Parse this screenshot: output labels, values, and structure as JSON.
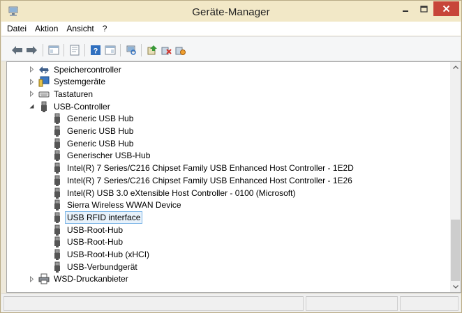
{
  "window": {
    "title": "Geräte-Manager",
    "accent_color": "#c7453a",
    "titlebar_color": "#f2e8c7"
  },
  "menu": {
    "items": [
      "Datei",
      "Aktion",
      "Ansicht",
      "?"
    ]
  },
  "toolbar": {
    "buttons": [
      "back-icon",
      "forward-icon",
      "show-hide-tree-icon",
      "properties-icon",
      "help-icon",
      "view-icon",
      "scan-hardware-icon",
      "update-driver-icon",
      "disable-device-icon",
      "uninstall-device-icon"
    ]
  },
  "tree": {
    "nodes": [
      {
        "label": "Speichercontroller",
        "level": 1,
        "state": "collapsed",
        "icon": "storage-controller-icon"
      },
      {
        "label": "Systemgeräte",
        "level": 1,
        "state": "collapsed",
        "icon": "system-devices-icon"
      },
      {
        "label": "Tastaturen",
        "level": 1,
        "state": "collapsed",
        "icon": "keyboard-icon"
      },
      {
        "label": "USB-Controller",
        "level": 1,
        "state": "expanded",
        "icon": "usb-icon"
      },
      {
        "label": "Generic USB Hub",
        "level": 2,
        "icon": "usb-device-icon"
      },
      {
        "label": "Generic USB Hub",
        "level": 2,
        "icon": "usb-device-icon"
      },
      {
        "label": "Generic USB Hub",
        "level": 2,
        "icon": "usb-device-icon"
      },
      {
        "label": "Generischer USB-Hub",
        "level": 2,
        "icon": "usb-device-icon"
      },
      {
        "label": "Intel(R) 7 Series/C216 Chipset Family USB Enhanced Host Controller - 1E2D",
        "level": 2,
        "icon": "usb-device-icon"
      },
      {
        "label": "Intel(R) 7 Series/C216 Chipset Family USB Enhanced Host Controller - 1E26",
        "level": 2,
        "icon": "usb-device-icon"
      },
      {
        "label": "Intel(R) USB 3.0 eXtensible Host Controller - 0100 (Microsoft)",
        "level": 2,
        "icon": "usb-device-icon"
      },
      {
        "label": "Sierra Wireless WWAN Device",
        "level": 2,
        "icon": "usb-device-icon"
      },
      {
        "label": "USB RFID interface",
        "level": 2,
        "icon": "usb-device-icon",
        "selected": true
      },
      {
        "label": "USB-Root-Hub",
        "level": 2,
        "icon": "usb-device-icon"
      },
      {
        "label": "USB-Root-Hub",
        "level": 2,
        "icon": "usb-device-icon"
      },
      {
        "label": "USB-Root-Hub (xHCI)",
        "level": 2,
        "icon": "usb-device-icon"
      },
      {
        "label": "USB-Verbundgerät",
        "level": 2,
        "icon": "usb-device-icon"
      },
      {
        "label": "WSD-Druckanbieter",
        "level": 1,
        "state": "collapsed",
        "icon": "printer-icon"
      }
    ]
  },
  "statusbar": {
    "text": ""
  }
}
